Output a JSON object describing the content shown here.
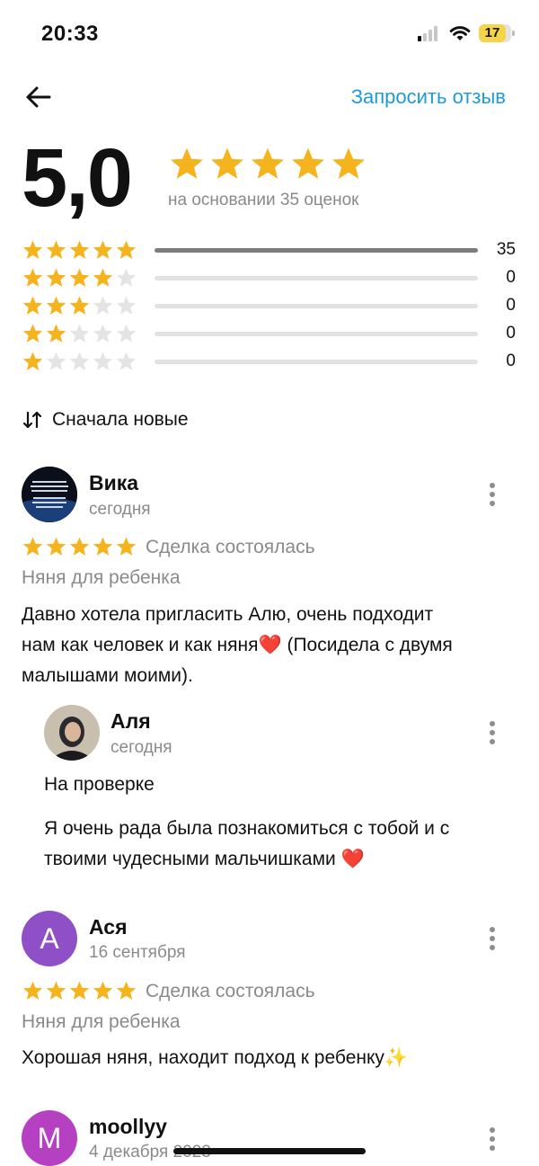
{
  "status_bar": {
    "time": "20:33",
    "battery": "17"
  },
  "header": {
    "request_review": "Запросить отзыв"
  },
  "summary": {
    "rating": "5,0",
    "based_on": "на основании 35 оценок",
    "histogram": [
      {
        "stars": 5,
        "count": "35",
        "fraction": 1.0
      },
      {
        "stars": 4,
        "count": "0",
        "fraction": 0
      },
      {
        "stars": 3,
        "count": "0",
        "fraction": 0
      },
      {
        "stars": 2,
        "count": "0",
        "fraction": 0
      },
      {
        "stars": 1,
        "count": "0",
        "fraction": 0
      }
    ]
  },
  "sort": {
    "label": "Сначала новые"
  },
  "reviews": [
    {
      "author": "Вика",
      "date": "сегодня",
      "deal": "Сделка состоялась",
      "category": "Няня для ребенка",
      "text_lines": [
        "Давно хотела пригласить Алю, очень подходит",
        "нам как человек и как няня❤️ (Посидела с двумя",
        "малышами моими)."
      ],
      "reply": {
        "author": "Аля",
        "date": "сегодня",
        "status": "На проверке",
        "text_lines": [
          "Я очень рада была познакомиться с тобой и с",
          "твоими чудесными мальчишками ❤️"
        ]
      }
    },
    {
      "author": "Ася",
      "avatar_letter": "А",
      "avatar_color": "#8e4fc7",
      "date": "16 сентября",
      "deal": "Сделка состоялась",
      "category": "Няня для ребенка",
      "text": "Хорошая няня, находит подход к ребенку✨"
    },
    {
      "author": "moollyy",
      "avatar_letter": "M",
      "avatar_color": "#b640c2",
      "date": "4 декабря 2023"
    }
  ],
  "colors": {
    "accent": "#1e9bd7",
    "star": "#f5b41e",
    "star_empty": "#e4e4e4"
  }
}
